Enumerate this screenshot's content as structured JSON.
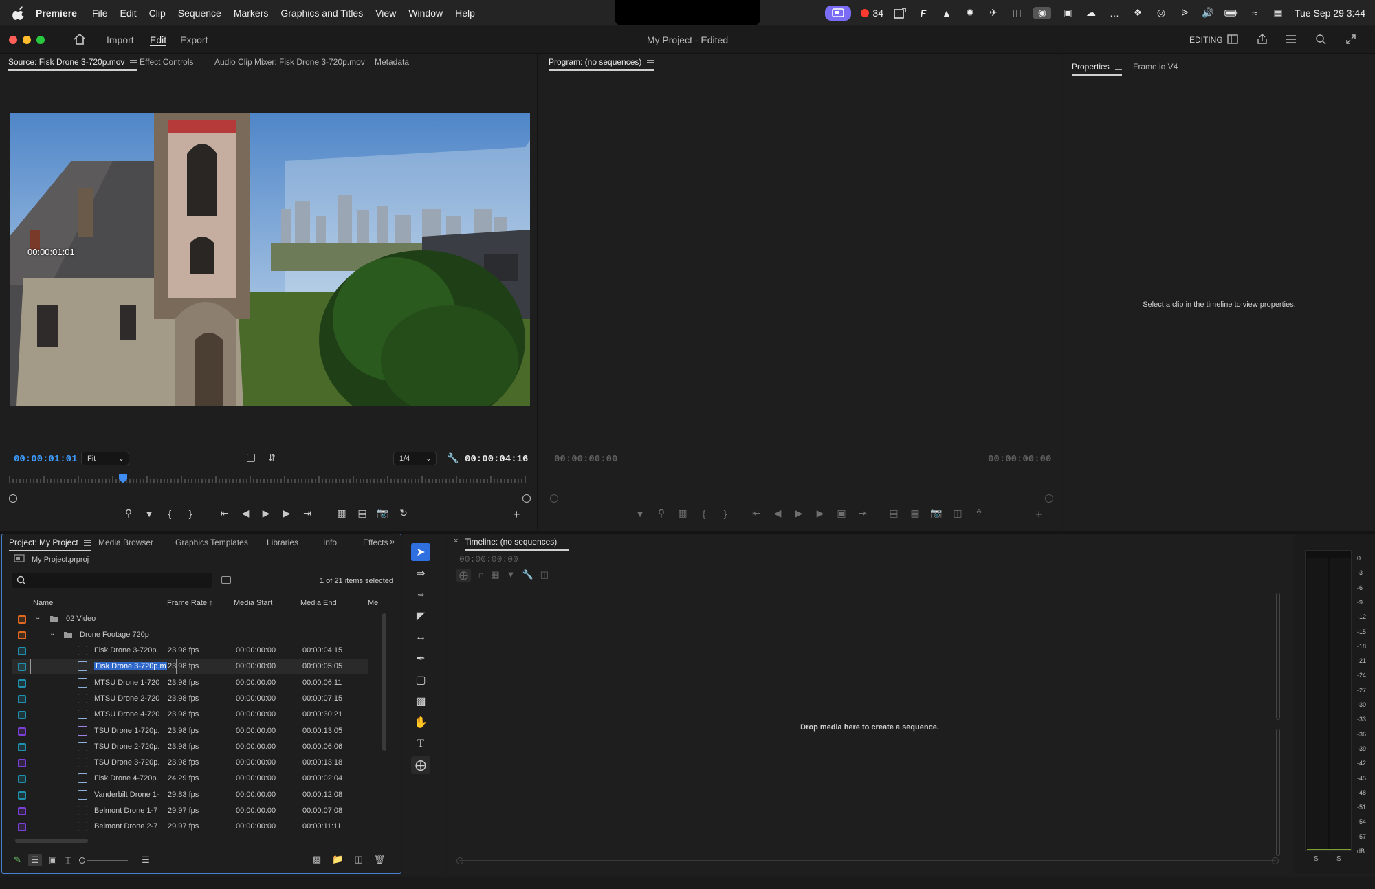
{
  "menubar": {
    "app": "Premiere",
    "items": [
      "File",
      "Edit",
      "Clip",
      "Sequence",
      "Markers",
      "Graphics and Titles",
      "View",
      "Window",
      "Help"
    ],
    "rec_count": "34",
    "datetime": "Tue Sep 29  3:44"
  },
  "header": {
    "nav": [
      "Import",
      "Edit",
      "Export"
    ],
    "project_title": "My Project",
    "project_state": " - Edited",
    "workspace": "EDITING"
  },
  "source_panel": {
    "tabs": [
      "Source: Fisk Drone 3-720p.mov",
      "Effect Controls",
      "Audio Clip Mixer: Fisk Drone 3-720p.mov",
      "Metadata"
    ],
    "overlay_timecode": "00:00:01:01",
    "current_timecode": "00:00:01:01",
    "fit": "Fit",
    "resolution": "1/4",
    "duration": "00:00:04:16",
    "playhead_fraction": 0.22
  },
  "program_panel": {
    "tab": "Program: (no sequences)",
    "timecode_left": "00:00:00:00",
    "timecode_right": "00:00:00:00"
  },
  "properties_panel": {
    "tabs": [
      "Properties",
      "Frame.io V4"
    ],
    "message": "Select a clip in the timeline to view properties."
  },
  "project_panel": {
    "tabs": [
      "Project: My Project",
      "Media Browser",
      "Graphics Templates",
      "Libraries",
      "Info",
      "Effects"
    ],
    "file": "My Project.prproj",
    "search_placeholder": "",
    "selection_info": "1 of 21 items selected",
    "columns": [
      "Name",
      "Frame Rate",
      "Media Start",
      "Media End",
      "Me"
    ],
    "folders": [
      {
        "name": "02 Video",
        "color": "#e0691f"
      },
      {
        "name": "Drone Footage 720p",
        "color": "#e0691f"
      }
    ],
    "items": [
      {
        "name": "Fisk Drone 3-720p.",
        "fr": "23.98 fps",
        "start": "00:00:00:00",
        "end": "00:00:04:15",
        "color": "#1f8fae",
        "icon": "blue"
      },
      {
        "name": "Fisk Drone 3-720p.m",
        "fr": "23.98 fps",
        "start": "00:00:00:00",
        "end": "00:00:05:05",
        "color": "#1f8fae",
        "icon": "blue",
        "selected": true
      },
      {
        "name": "MTSU Drone 1-720",
        "fr": "23.98 fps",
        "start": "00:00:00:00",
        "end": "00:00:06:11",
        "color": "#1f8fae",
        "icon": "blue"
      },
      {
        "name": "MTSU Drone 2-720",
        "fr": "23.98 fps",
        "start": "00:00:00:00",
        "end": "00:00:07:15",
        "color": "#1f8fae",
        "icon": "blue"
      },
      {
        "name": "MTSU Drone 4-720",
        "fr": "23.98 fps",
        "start": "00:00:00:00",
        "end": "00:00:30:21",
        "color": "#1f8fae",
        "icon": "blue"
      },
      {
        "name": "TSU Drone 1-720p.",
        "fr": "23.98 fps",
        "start": "00:00:00:00",
        "end": "00:00:13:05",
        "color": "#7b3fd8",
        "icon": "purple"
      },
      {
        "name": "TSU Drone 2-720p.",
        "fr": "23.98 fps",
        "start": "00:00:00:00",
        "end": "00:00:06:06",
        "color": "#1f8fae",
        "icon": "blue"
      },
      {
        "name": "TSU Drone 3-720p.",
        "fr": "23.98 fps",
        "start": "00:00:00:00",
        "end": "00:00:13:18",
        "color": "#7b3fd8",
        "icon": "purple"
      },
      {
        "name": "Fisk Drone 4-720p.",
        "fr": "24.29 fps",
        "start": "00:00:00:00",
        "end": "00:00:02:04",
        "color": "#1f8fae",
        "icon": "blue"
      },
      {
        "name": "Vanderbilt Drone 1-",
        "fr": "29.83 fps",
        "start": "00:00:00:00",
        "end": "00:00:12:08",
        "color": "#1f8fae",
        "icon": "blue"
      },
      {
        "name": "Belmont Drone 1-7",
        "fr": "29.97 fps",
        "start": "00:00:00:00",
        "end": "00:00:07:08",
        "color": "#7b3fd8",
        "icon": "purple"
      },
      {
        "name": "Belmont Drone 2-7",
        "fr": "29.97 fps",
        "start": "00:00:00:00",
        "end": "00:00:11:11",
        "color": "#7b3fd8",
        "icon": "purple"
      }
    ]
  },
  "timeline_panel": {
    "tab": "Timeline: (no sequences)",
    "timecode": "00:00:00:00",
    "message": "Drop media here to create a sequence."
  },
  "audio_meter": {
    "scale": [
      "0",
      "-3",
      "-6",
      "-9",
      "-12",
      "-15",
      "-18",
      "-21",
      "-24",
      "-27",
      "-30",
      "-33",
      "-36",
      "-39",
      "-42",
      "-45",
      "-48",
      "-51",
      "-54",
      "-57",
      "dB"
    ],
    "solo": [
      "S",
      "S"
    ]
  }
}
